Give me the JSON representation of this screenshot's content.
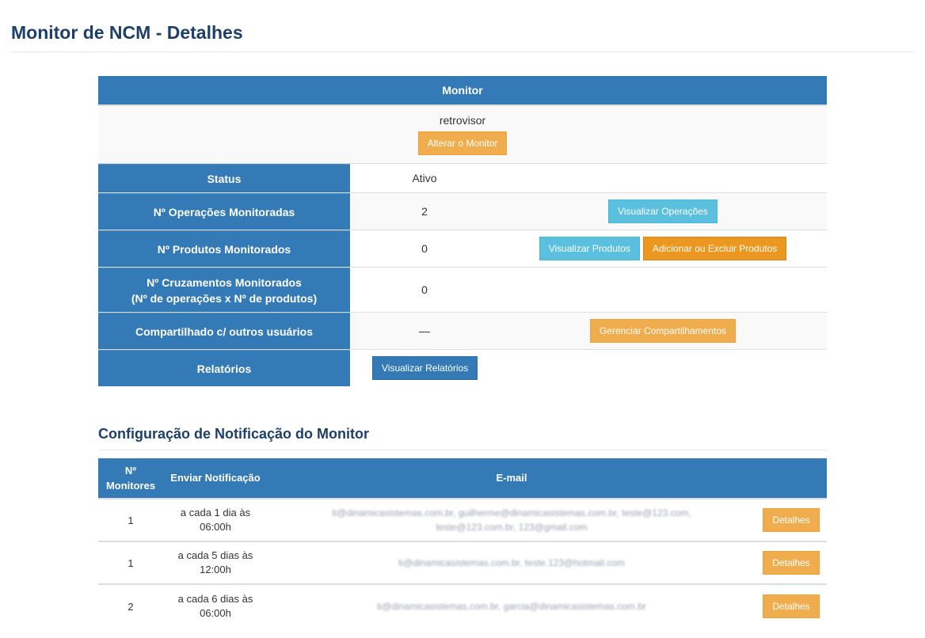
{
  "page": {
    "title": "Monitor de NCM - Detalhes"
  },
  "monitor": {
    "header": "Monitor",
    "name": "retrovisor",
    "change_button": "Alterar o Monitor",
    "rows": {
      "status": {
        "label": "Status",
        "value": "Ativo"
      },
      "operacoes": {
        "label": "Nº Operações Monitoradas",
        "value": "2",
        "button": "Visualizar Operações"
      },
      "produtos": {
        "label": "Nº Produtos Monitorados",
        "value": "0",
        "button_view": "Visualizar Produtos",
        "button_edit": "Adicionar ou Excluir Produtos"
      },
      "cruzamentos": {
        "label_line1": "Nº Cruzamentos Monitorados",
        "label_line2": "(Nº de operações x Nº de produtos)",
        "value": "0"
      },
      "compartilhado": {
        "label": "Compartilhado c/ outros usuários",
        "value": "—",
        "button": "Gerenciar Compartilhamentos"
      },
      "relatorios": {
        "label": "Relatórios",
        "button": "Visualizar Relatórios"
      }
    }
  },
  "notifications": {
    "title": "Configuração de Notificação do Monitor",
    "columns": {
      "monitores_line1": "Nº",
      "monitores_line2": "Monitores",
      "enviar": "Enviar Notificação",
      "email": "E-mail"
    },
    "rows": [
      {
        "monitores": "1",
        "enviar_line1": "a cada 1 dia às",
        "enviar_line2": "06:00h",
        "email": "ti@dinamicasistemas.com.br, guilherme@dinamicasistemas.com.br, teste@123.com, teste@123.com.br, 123@gmail.com",
        "button": "Detalhes"
      },
      {
        "monitores": "1",
        "enviar_line1": "a cada 5 dias às",
        "enviar_line2": "12:00h",
        "email": "ti@dinamicasistemas.com.br, teste.123@hotmail.com",
        "button": "Detalhes"
      },
      {
        "monitores": "2",
        "enviar_line1": "a cada 6 dias às",
        "enviar_line2": "06:00h",
        "email": "ti@dinamicasistemas.com.br, garcia@dinamicasistemas.com.br",
        "button": "Detalhes"
      }
    ]
  }
}
